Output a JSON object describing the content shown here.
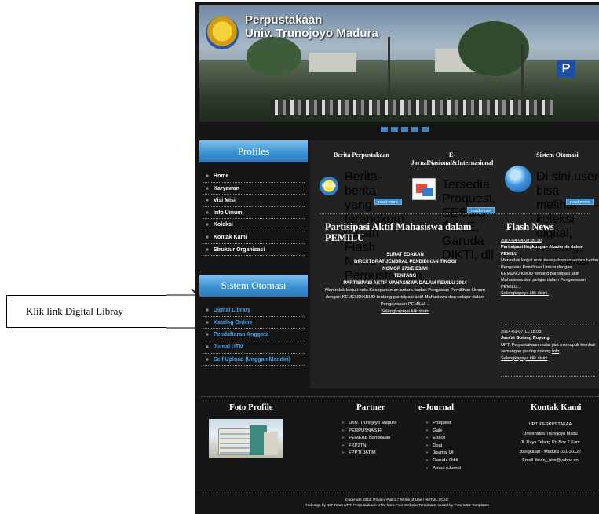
{
  "callout": {
    "text": "Klik link Digital Libray"
  },
  "banner": {
    "title_line1": "Perpustakaan",
    "title_line2": "Univ. Trunojoyo Madura",
    "parking_sign": "P",
    "slider_dot_count": 5
  },
  "sidebar": {
    "profiles_heading": "Profiles",
    "profiles_items": [
      "Home",
      "Karyawan",
      "Visi Misi",
      "Info Umum",
      "Koleksi",
      "Kontak Kami",
      "Struktur Organisasi"
    ],
    "sistem_heading": "Sistem Otomasi",
    "sistem_items": [
      "Digital Library",
      "Katalog Online",
      "Pendaftaran Anggota",
      "Jurnal UTM",
      "Self Upload (Unggah Mandiri)"
    ],
    "chevron": "»"
  },
  "content": {
    "berita": {
      "heading": "Berita Perpustakaan",
      "text": "Berita-berita yang terangkum dalam Flash News Perpustakaan",
      "more": "read more",
      "thumb_label": "NEWS"
    },
    "ejournal": {
      "heading_line1": "E-",
      "heading_line2": "JornalNasional&Internasional",
      "text": "Tersedia Proquest, EESCO, GALE, Garuda DIKTI, dll",
      "more": "read more"
    },
    "sistem": {
      "heading": "Sistem Otomasi",
      "text": "Di sini user bisa melihat koleksi digital, Katalog, Pendaftar",
      "more": "read more"
    },
    "article": {
      "title": "Partisipasi Aktif Mahasiswa dalam PEMILU",
      "line1": "SURAT EDARAN",
      "line2": "DIREKTORAT JENDRAL PENDIDIKAN TINGGI",
      "line3": "NOMOR 273/E.E3/MI",
      "line4": "TENTANG",
      "line5": "PARTISIPASI AKTIF MAHASISWA DALAM PEMILU 2014",
      "body": "Menindak lanjuti nota Kesepahaman antara badan Pengawas Pemilihan Umum dengan KEMENDIKBUD tentang partisipasi aktif Mahasiswa dan pelajar dalam Pengawasan PEMILU…",
      "link": "Selengkapnya klik disini"
    },
    "flash": {
      "heading": "Flash News",
      "items": [
        {
          "date": "2014-04-04 08:26:30",
          "title": "Partisipasi lingkungan Akademik dalam PEMILU",
          "body": "Menindak lanjuti nota kesepahaman antara badan Pengawas Pemilihan Umum dengan KEMENDIKBUD tentang partisipasi aktif Mahasiswa dan pelajar dalam Pengawasan PEMILU…",
          "link": "Selengkapnya klik disini."
        },
        {
          "date": "2014-03-07 11:18:03",
          "title": "Jum'at Gotong Royong",
          "body": "UPT. Perpustakaan mulai giat memupuk kembali semangan gotong royong",
          "link_a": "Info",
          "link_b": "Selengkapnya klik disini"
        }
      ]
    }
  },
  "footer": {
    "foto_heading": "Foto Profile",
    "partner_heading": "Partner",
    "partner_items": [
      "Univ. Trunojoyo Madura",
      "PERPUSNAS RI",
      "PEMKAB Bangkalan",
      "FKP2TN",
      "FPPTI JATIM"
    ],
    "ejournal_heading": "e-Journal",
    "ejournal_items": [
      "Proquest",
      "Gale",
      "Ebsco",
      "Doaj",
      "Journal UI",
      "Garuda Dikti",
      "About eJurnal"
    ],
    "kontak_heading": "Kontak Kami",
    "kontak_lines": [
      "UPT. PERPUSTAKAA",
      "Universitas Trunojoyo Madu",
      "Jl. Raya Telang Po.Box.2 Kam",
      "Bangkalan - Madura 031-30127",
      "Email library_utm@yahoo.co"
    ],
    "copyright_line1": "Copyright 2012. Privacy Policy | Terms of Use | XHTML | CSS",
    "copyright_line2": "Redesign by ICT Team UPT. Perpustakaan UTM from Free Website Templates, coded by Free CSS Templates"
  }
}
